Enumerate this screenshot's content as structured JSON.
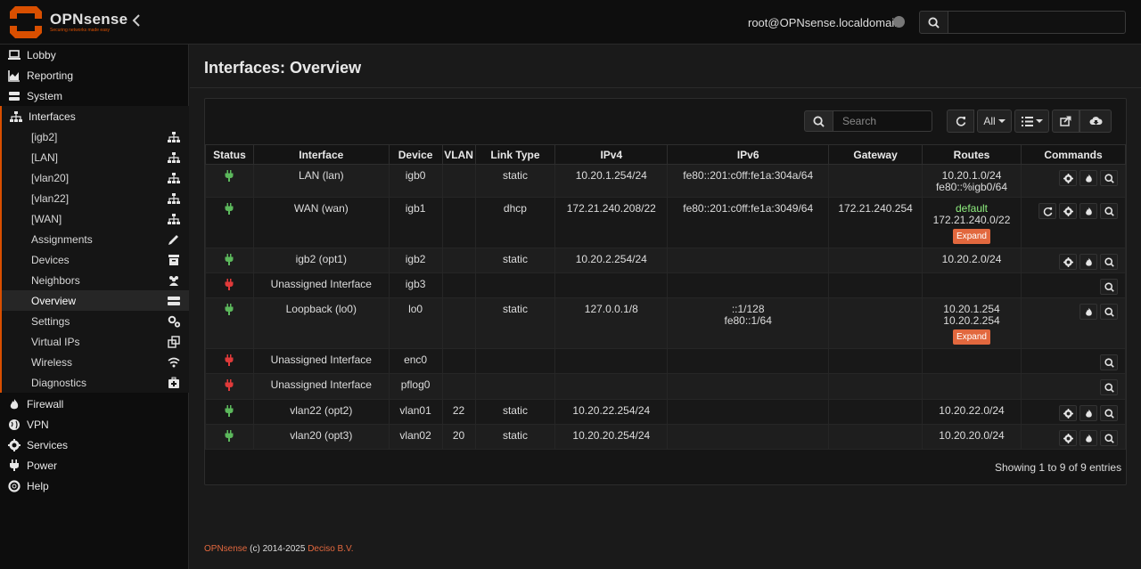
{
  "header": {
    "brand": "OPNsense",
    "tagline": "Securing networks made easy",
    "user": "root@OPNsense.localdomain",
    "search_placeholder": ""
  },
  "sidebar": {
    "items": [
      {
        "label": "Lobby",
        "icon": "laptop-icon"
      },
      {
        "label": "Reporting",
        "icon": "area-chart-icon"
      },
      {
        "label": "System",
        "icon": "server-icon"
      },
      {
        "label": "Interfaces",
        "icon": "sitemap-icon"
      }
    ],
    "interfaces_sub": [
      {
        "label": "[igb2]",
        "icon": "sitemap-icon"
      },
      {
        "label": "[LAN]",
        "icon": "sitemap-icon"
      },
      {
        "label": "[vlan20]",
        "icon": "sitemap-icon"
      },
      {
        "label": "[vlan22]",
        "icon": "sitemap-icon"
      },
      {
        "label": "[WAN]",
        "icon": "sitemap-icon"
      },
      {
        "label": "Assignments",
        "icon": "pencil-icon"
      },
      {
        "label": "Devices",
        "icon": "archive-icon"
      },
      {
        "label": "Neighbors",
        "icon": "users-icon"
      },
      {
        "label": "Overview",
        "icon": "tasks-icon"
      },
      {
        "label": "Settings",
        "icon": "cogs-icon"
      },
      {
        "label": "Virtual IPs",
        "icon": "clone-icon"
      },
      {
        "label": "Wireless",
        "icon": "wifi-icon"
      },
      {
        "label": "Diagnostics",
        "icon": "medkit-icon"
      }
    ],
    "bottom_items": [
      {
        "label": "Firewall",
        "icon": "fire-icon"
      },
      {
        "label": "VPN",
        "icon": "globe-icon"
      },
      {
        "label": "Services",
        "icon": "cog-icon"
      },
      {
        "label": "Power",
        "icon": "plug-icon"
      },
      {
        "label": "Help",
        "icon": "life-ring-icon"
      }
    ]
  },
  "main": {
    "title": "Interfaces: Overview",
    "search_placeholder": "Search",
    "page_size": "All",
    "columns": [
      "Status",
      "Interface",
      "Device",
      "VLAN",
      "Link Type",
      "IPv4",
      "IPv6",
      "Gateway",
      "Routes",
      "Commands"
    ],
    "rows": [
      {
        "status": "up",
        "interface": "LAN (lan)",
        "device": "igb0",
        "vlan": "",
        "link_type": "static",
        "ipv4": "10.20.1.254/24",
        "ipv6": [
          "fe80::201:c0ff:fe1a:304a/64"
        ],
        "gateway": "",
        "routes": [
          "10.20.1.0/24",
          "fe80::%igb0/64"
        ],
        "routes_default": false,
        "expand": false,
        "cmds": [
          "cog",
          "fire",
          "search"
        ]
      },
      {
        "status": "up",
        "interface": "WAN (wan)",
        "device": "igb1",
        "vlan": "",
        "link_type": "dhcp",
        "ipv4": "172.21.240.208/22",
        "ipv6": [
          "fe80::201:c0ff:fe1a:3049/64"
        ],
        "gateway": "172.21.240.254",
        "routes": [
          "default",
          "172.21.240.0/22"
        ],
        "routes_default": true,
        "expand": true,
        "cmds": [
          "refresh",
          "cog",
          "fire",
          "search"
        ]
      },
      {
        "status": "up",
        "interface": "igb2 (opt1)",
        "device": "igb2",
        "vlan": "",
        "link_type": "static",
        "ipv4": "10.20.2.254/24",
        "ipv6": [],
        "gateway": "",
        "routes": [
          "10.20.2.0/24"
        ],
        "routes_default": false,
        "expand": false,
        "cmds": [
          "cog",
          "fire",
          "search"
        ]
      },
      {
        "status": "down",
        "interface": "Unassigned Interface",
        "device": "igb3",
        "vlan": "",
        "link_type": "",
        "ipv4": "",
        "ipv6": [],
        "gateway": "",
        "routes": [],
        "routes_default": false,
        "expand": false,
        "cmds": [
          "search"
        ]
      },
      {
        "status": "up",
        "interface": "Loopback (lo0)",
        "device": "lo0",
        "vlan": "",
        "link_type": "static",
        "ipv4": "127.0.0.1/8",
        "ipv6": [
          "::1/128",
          "fe80::1/64"
        ],
        "gateway": "",
        "routes": [
          "10.20.1.254",
          "10.20.2.254"
        ],
        "routes_default": false,
        "expand": true,
        "cmds": [
          "fire",
          "search"
        ]
      },
      {
        "status": "down",
        "interface": "Unassigned Interface",
        "device": "enc0",
        "vlan": "",
        "link_type": "",
        "ipv4": "",
        "ipv6": [],
        "gateway": "",
        "routes": [],
        "routes_default": false,
        "expand": false,
        "cmds": [
          "search"
        ]
      },
      {
        "status": "down",
        "interface": "Unassigned Interface",
        "device": "pflog0",
        "vlan": "",
        "link_type": "",
        "ipv4": "",
        "ipv6": [],
        "gateway": "",
        "routes": [],
        "routes_default": false,
        "expand": false,
        "cmds": [
          "search"
        ]
      },
      {
        "status": "up",
        "interface": "vlan22 (opt2)",
        "device": "vlan01",
        "vlan": "22",
        "link_type": "static",
        "ipv4": "10.20.22.254/24",
        "ipv6": [],
        "gateway": "",
        "routes": [
          "10.20.22.0/24"
        ],
        "routes_default": false,
        "expand": false,
        "cmds": [
          "cog",
          "fire",
          "search"
        ]
      },
      {
        "status": "up",
        "interface": "vlan20 (opt3)",
        "device": "vlan02",
        "vlan": "20",
        "link_type": "static",
        "ipv4": "10.20.20.254/24",
        "ipv6": [],
        "gateway": "",
        "routes": [
          "10.20.20.0/24"
        ],
        "routes_default": false,
        "expand": false,
        "cmds": [
          "cog",
          "fire",
          "search"
        ]
      }
    ],
    "expand_label": "Expand",
    "footer_text": "Showing 1 to 9 of 9 entries"
  },
  "footer": {
    "brand": "OPNsense",
    "copy": "(c) 2014-2025",
    "company": "Deciso B.V."
  },
  "colors": {
    "accent": "#d94f00",
    "status_up": "#5cb85c",
    "status_down": "#e03a3a",
    "expand": "#e2683e",
    "default_route": "#8fef7f"
  }
}
